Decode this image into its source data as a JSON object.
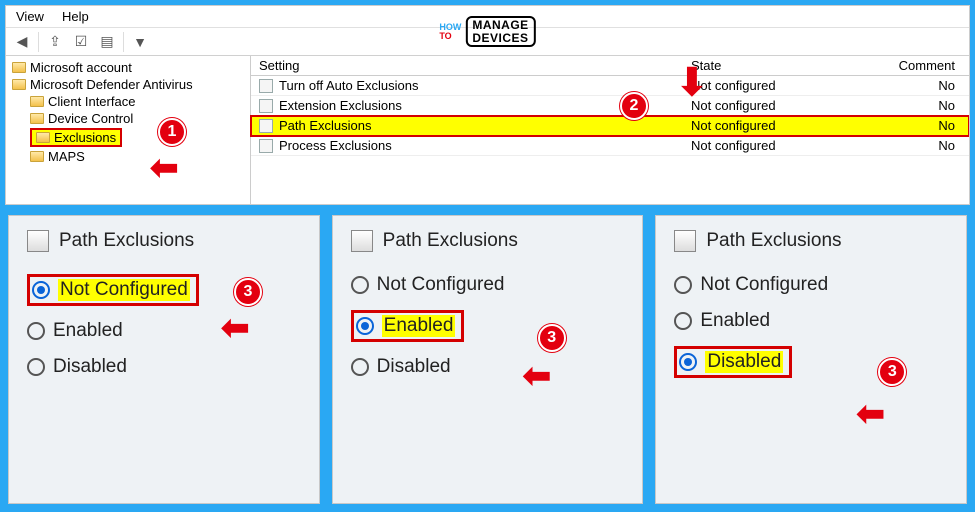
{
  "menu": {
    "view": "View",
    "help": "Help"
  },
  "tree": {
    "root1": "Microsoft account",
    "root2": "Microsoft Defender Antivirus",
    "children": [
      "Client Interface",
      "Device Control",
      "Exclusions",
      "MAPS"
    ]
  },
  "list": {
    "header": {
      "setting": "Setting",
      "state": "State",
      "comment": "Comment"
    },
    "rows": [
      {
        "setting": "Turn off Auto Exclusions",
        "state": "Not configured",
        "comment": "No"
      },
      {
        "setting": "Extension Exclusions",
        "state": "Not configured",
        "comment": "No"
      },
      {
        "setting": "Path Exclusions",
        "state": "Not configured",
        "comment": "No"
      },
      {
        "setting": "Process Exclusions",
        "state": "Not configured",
        "comment": "No"
      }
    ]
  },
  "dialog": {
    "title": "Path Exclusions",
    "opt_notconfig": "Not Configured",
    "opt_enabled": "Enabled",
    "opt_disabled": "Disabled"
  },
  "badges": {
    "b1": "1",
    "b2": "2",
    "b3": "3"
  },
  "watermark": {
    "how": "HOW",
    "to": "TO",
    "line1": "MANAGE",
    "line2": "DEVICES"
  }
}
